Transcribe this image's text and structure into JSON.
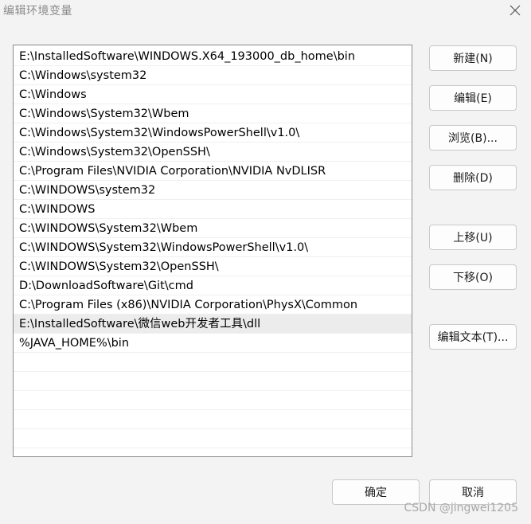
{
  "window": {
    "title": "编辑环境变量"
  },
  "path_list": {
    "selected_index": 14,
    "items": [
      "E:\\InstalledSoftware\\WINDOWS.X64_193000_db_home\\bin",
      "C:\\Windows\\system32",
      "C:\\Windows",
      "C:\\Windows\\System32\\Wbem",
      "C:\\Windows\\System32\\WindowsPowerShell\\v1.0\\",
      "C:\\Windows\\System32\\OpenSSH\\",
      "C:\\Program Files\\NVIDIA Corporation\\NVIDIA NvDLISR",
      "C:\\WINDOWS\\system32",
      "C:\\WINDOWS",
      "C:\\WINDOWS\\System32\\Wbem",
      "C:\\WINDOWS\\System32\\WindowsPowerShell\\v1.0\\",
      "C:\\WINDOWS\\System32\\OpenSSH\\",
      "D:\\DownloadSoftware\\Git\\cmd",
      "C:\\Program Files (x86)\\NVIDIA Corporation\\PhysX\\Common",
      "E:\\InstalledSoftware\\微信web开发者工具\\dll",
      "%JAVA_HOME%\\bin",
      "",
      "",
      "",
      "",
      "",
      ""
    ]
  },
  "buttons": {
    "new": "新建(N)",
    "edit": "编辑(E)",
    "browse": "浏览(B)...",
    "delete": "删除(D)",
    "move_up": "上移(U)",
    "move_down": "下移(O)",
    "edit_text": "编辑文本(T)...",
    "ok": "确定",
    "cancel": "取消"
  },
  "watermark": "CSDN @jingwei1205",
  "icons": {
    "close": "close-icon"
  }
}
